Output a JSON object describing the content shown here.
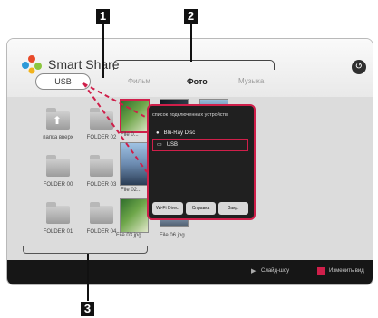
{
  "callouts": [
    "1",
    "2",
    "3"
  ],
  "header": {
    "brand": "Smart Share",
    "source_button": "USB",
    "tabs": [
      {
        "label": "Фильм",
        "selected": false
      },
      {
        "label": "Фото",
        "selected": true
      },
      {
        "label": "Музыка",
        "selected": false
      }
    ],
    "back_icon": "↺"
  },
  "folders": [
    {
      "label": "папка вверх",
      "icon": "folder-up-icon"
    },
    {
      "label": "FOLDER 02",
      "icon": "folder-icon"
    },
    {
      "label": "FOLDER 00",
      "icon": "folder-icon"
    },
    {
      "label": "FOLDER 03",
      "icon": "folder-icon"
    },
    {
      "label": "FOLDER 01",
      "icon": "folder-icon"
    },
    {
      "label": "FOLDER 04",
      "icon": "folder-icon"
    }
  ],
  "files": [
    {
      "label": "File 0..."
    },
    {
      "label": "File 02..."
    },
    {
      "label": "File 03.jpg"
    },
    {
      "label": "File 06.jpg"
    }
  ],
  "popup": {
    "title": "список подключенных устройств",
    "options": [
      {
        "label": "Blu-Ray Disc",
        "icon": "disc-icon"
      },
      {
        "label": "USB",
        "icon": "usb-icon",
        "selected": true
      }
    ],
    "buttons": [
      "Wi-Fi Direct",
      "Справка",
      "Закр."
    ]
  },
  "footer": {
    "slideshow": "Слайд-шоу",
    "change_view": "Изменить вид"
  },
  "colors": {
    "accent": "#cf1f4a",
    "footer_bg": "#161616"
  }
}
